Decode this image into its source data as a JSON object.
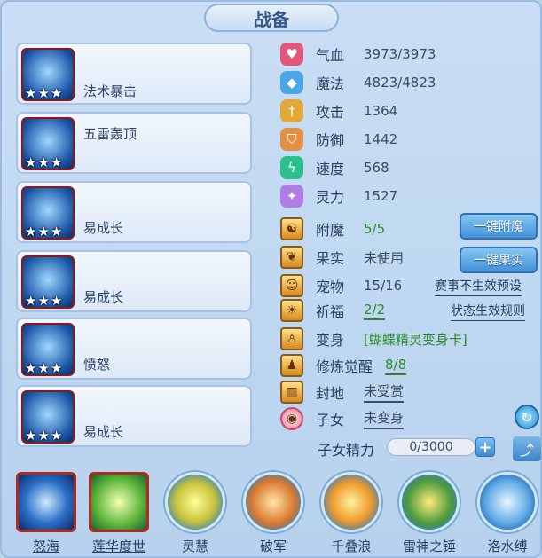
{
  "title": "战备",
  "skills": [
    {
      "name": "法术暴击",
      "stars": "★★★"
    },
    {
      "name": "五雷轰顶",
      "stars": "★★★"
    },
    {
      "name": "易成长",
      "stars": "★★★"
    },
    {
      "name": "易成长",
      "stars": "★★★"
    },
    {
      "name": "愤怒",
      "stars": "★★★"
    },
    {
      "name": "易成长",
      "stars": "★★★"
    }
  ],
  "stats": [
    {
      "label": "气血",
      "value": "3973/3973",
      "icon": "heart-icon",
      "color": "#e2577a"
    },
    {
      "label": "魔法",
      "value": "4823/4823",
      "icon": "droplet-icon",
      "color": "#4aa6e7"
    },
    {
      "label": "攻击",
      "value": "1364",
      "icon": "sword-icon",
      "color": "#e2a93a"
    },
    {
      "label": "防御",
      "value": "1442",
      "icon": "shield-icon",
      "color": "#e39046"
    },
    {
      "label": "速度",
      "value": "568",
      "icon": "lightning-icon",
      "color": "#2ebf8f"
    },
    {
      "label": "灵力",
      "value": "1527",
      "icon": "sparkle-icon",
      "color": "#b07de6"
    }
  ],
  "attrs": [
    {
      "label": "附魔",
      "value": "5/5",
      "icon": "enchant-icon",
      "glyph": "☯"
    },
    {
      "label": "果实",
      "value": "未使用",
      "icon": "fruit-icon",
      "glyph": "❦"
    },
    {
      "label": "宠物",
      "value": "15/16",
      "icon": "pet-icon",
      "glyph": "☺"
    },
    {
      "label": "祈福",
      "value": "2/2",
      "icon": "blessing-icon",
      "glyph": "☀"
    },
    {
      "label": "变身",
      "value": "[蝴蝶精灵变身卡]",
      "icon": "transform-icon",
      "glyph": "♙"
    },
    {
      "label": "修炼觉醒",
      "value": "8/8",
      "icon": "cultivation-icon",
      "glyph": "♟"
    },
    {
      "label": "封地",
      "value": "未受赏",
      "icon": "fief-icon",
      "glyph": "▥"
    },
    {
      "label": "子女",
      "value": "未变身",
      "icon": "child-icon",
      "glyph": "◉"
    }
  ],
  "buttons": {
    "enchant": "一键附魔",
    "fruit": "一键果实"
  },
  "links": {
    "event": "赛事不生效预设",
    "status": "状态生效规则"
  },
  "child_energy": {
    "label": "子女精力",
    "value": "0/3000",
    "progress": 0
  },
  "bottom_skills": [
    {
      "name": "怒海"
    },
    {
      "name": "莲华度世"
    },
    {
      "name": "灵慧"
    },
    {
      "name": "破军"
    },
    {
      "name": "千叠浪"
    },
    {
      "name": "雷神之锤"
    },
    {
      "name": "洛水缚"
    }
  ]
}
